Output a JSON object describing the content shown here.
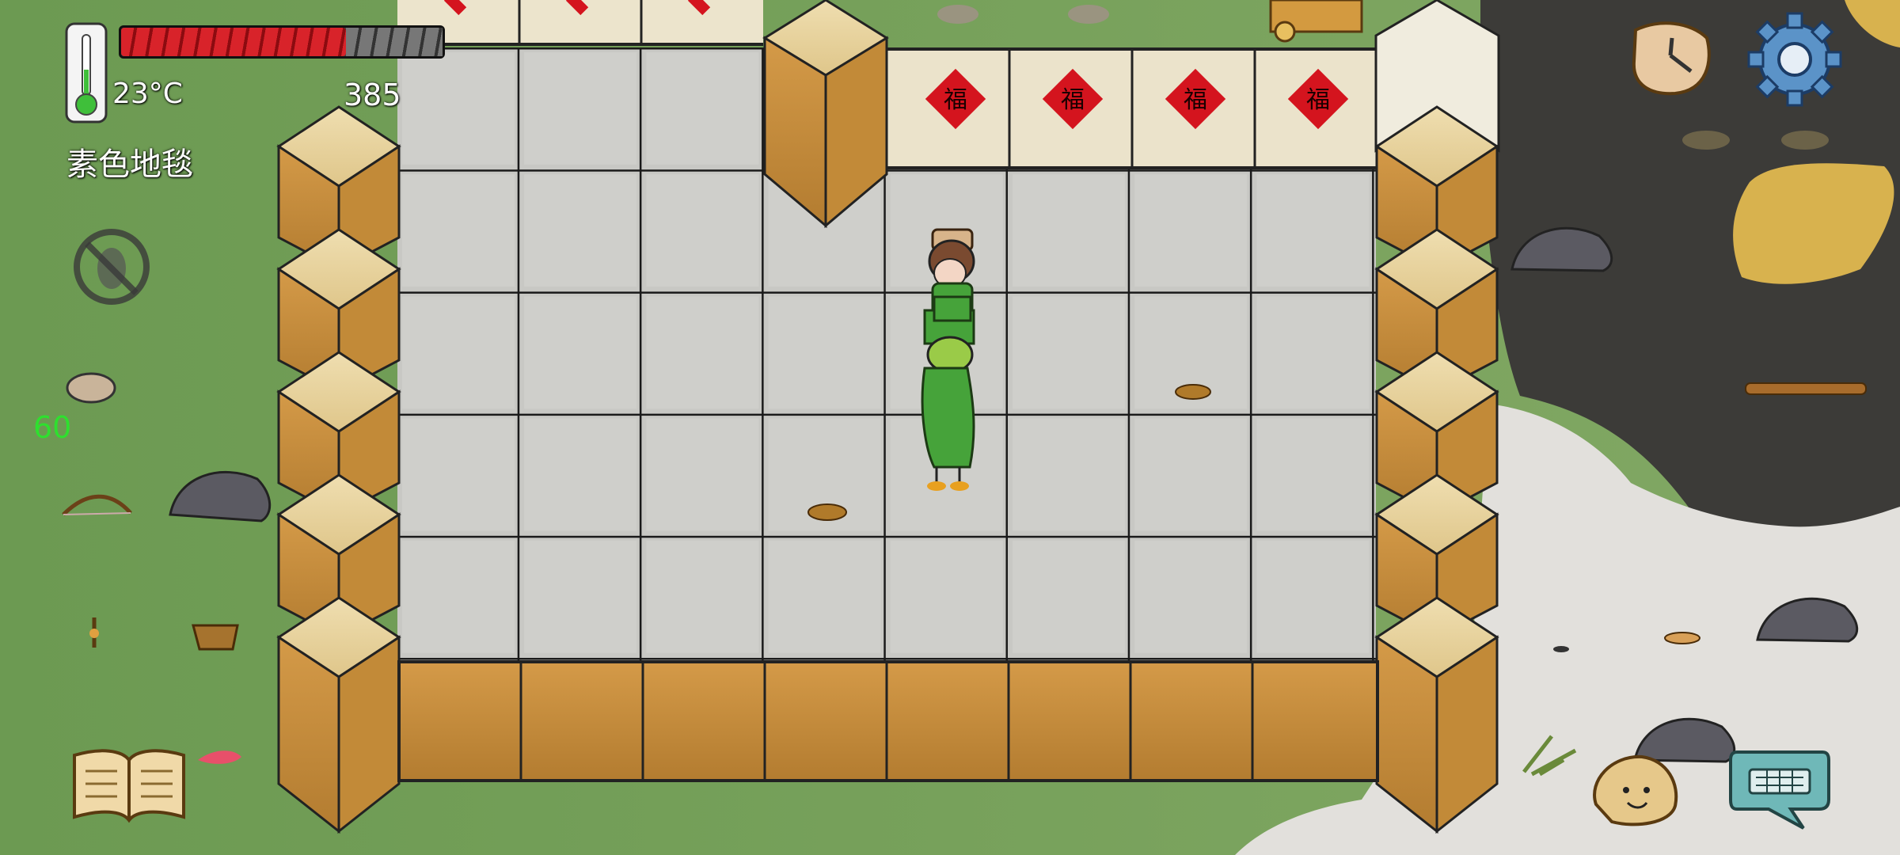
{
  "hud": {
    "temperature": "23°C",
    "food_bar_fraction": 0.7,
    "yum_count": "385",
    "tile_name": "素色地毯",
    "fps": "60",
    "fps_color": "#2ee02e"
  },
  "icons": {
    "thermometer": "thermometer-icon",
    "no_bugs": "no-bugs-icon",
    "journal": "open-book-icon",
    "clock": "melting-clock-icon",
    "settings": "gear-icon",
    "emote": "emote-face-icon",
    "chat": "keyboard-chat-icon"
  },
  "decorations": {
    "door_banner_char": "福"
  },
  "colors": {
    "food_bar_fill": "#d8232a",
    "food_bar_empty": "#6a6a6a",
    "grass": "#6f9a55",
    "floor": "#c6c6c2",
    "wall_tan": "#e9d6a0",
    "wall_orange": "#c98f3a",
    "banner_red": "#d4141e",
    "avatar_green": "#46a33a"
  }
}
